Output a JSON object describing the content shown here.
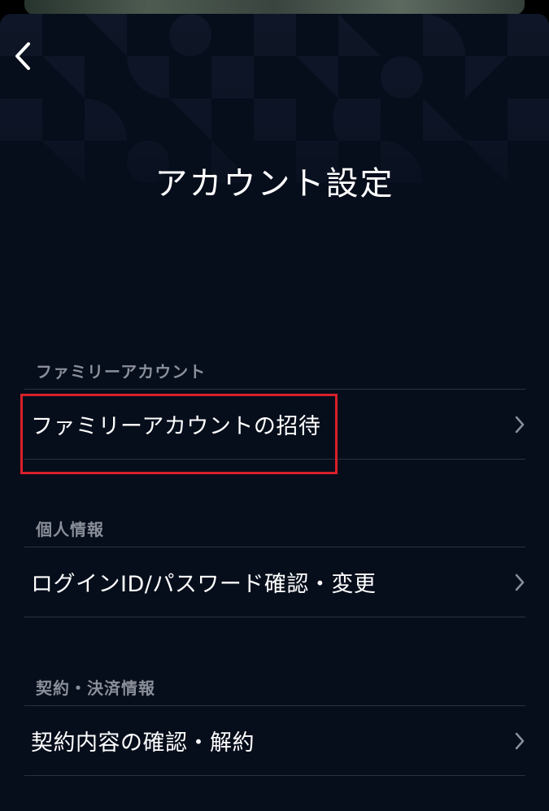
{
  "header": {
    "title": "アカウント設定"
  },
  "sections": [
    {
      "label": "ファミリーアカウント",
      "items": [
        {
          "label": "ファミリーアカウントの招待"
        }
      ]
    },
    {
      "label": "個人情報",
      "items": [
        {
          "label": "ログインID/パスワード確認・変更"
        }
      ]
    },
    {
      "label": "契約・決済情報",
      "items": [
        {
          "label": "契約内容の確認・解約"
        }
      ]
    }
  ],
  "icons": {
    "back": "chevron-left-icon",
    "row_arrow": "chevron-right-icon"
  },
  "colors": {
    "background": "#060d1b",
    "text": "#ffffff",
    "section_label": "#8a8f99",
    "divider": "#2a3140",
    "highlight": "#d8202a"
  }
}
